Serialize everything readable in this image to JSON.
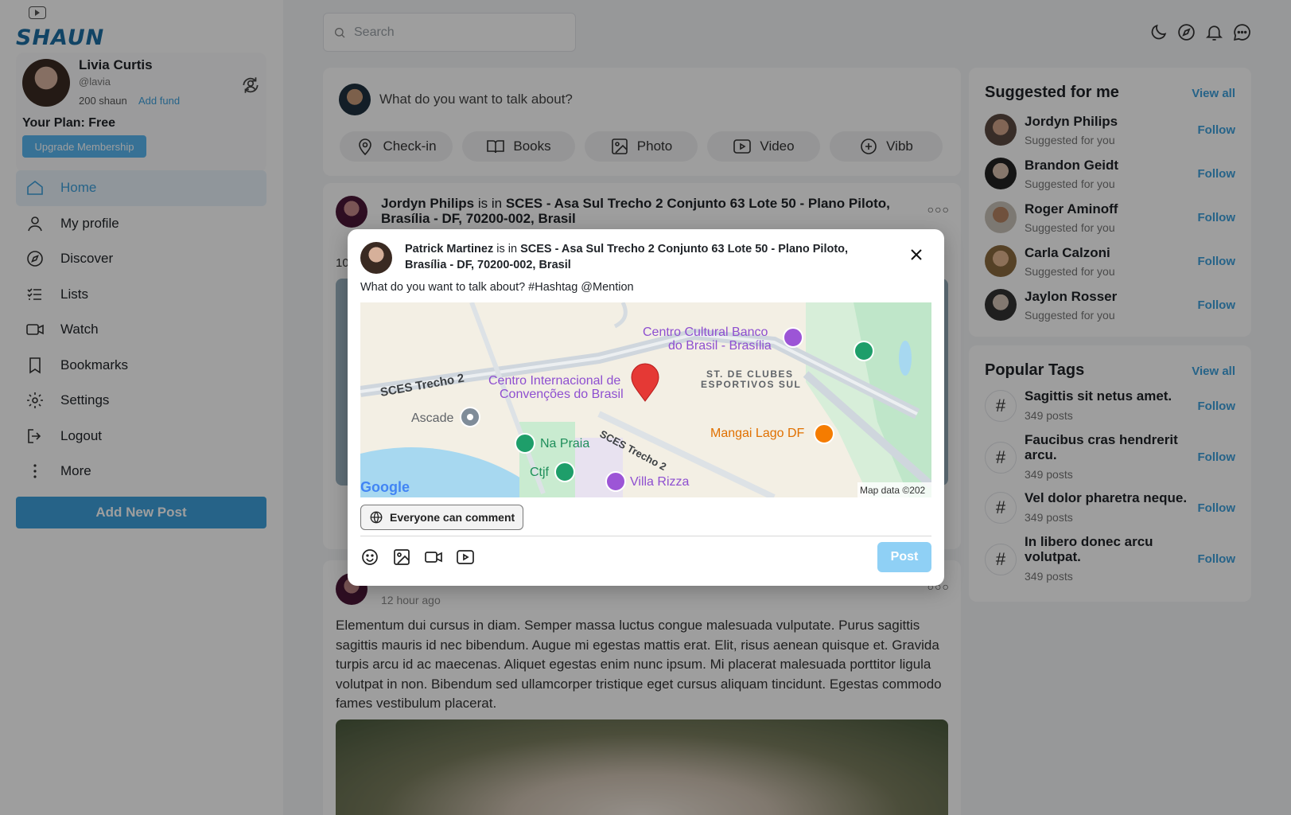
{
  "app": {
    "logo": "SHAUN"
  },
  "profile": {
    "name": "Livia Curtis",
    "handle": "@lavia",
    "balance": "200 shaun",
    "add_fund": "Add fund",
    "plan": "Your Plan: Free",
    "upgrade": "Upgrade Membership"
  },
  "nav": [
    {
      "label": "Home",
      "icon": "home-icon"
    },
    {
      "label": "My profile",
      "icon": "user-icon"
    },
    {
      "label": "Discover",
      "icon": "compass-icon"
    },
    {
      "label": "Lists",
      "icon": "list-icon"
    },
    {
      "label": "Watch",
      "icon": "video-icon"
    },
    {
      "label": "Bookmarks",
      "icon": "bookmark-icon"
    },
    {
      "label": "Settings",
      "icon": "gear-icon"
    },
    {
      "label": "Logout",
      "icon": "logout-icon"
    },
    {
      "label": "More",
      "icon": "more-vertical-icon"
    }
  ],
  "add_post": "Add New Post",
  "search": {
    "placeholder": "Search"
  },
  "composer": {
    "prompt": "What do you want to talk about?",
    "chips": [
      {
        "label": "Check-in",
        "icon": "location-pin-icon"
      },
      {
        "label": "Books",
        "icon": "book-icon"
      },
      {
        "label": "Photo",
        "icon": "image-icon"
      },
      {
        "label": "Video",
        "icon": "video-play-icon"
      },
      {
        "label": "Vibb",
        "icon": "plus-circle-icon"
      }
    ]
  },
  "feed": {
    "post1": {
      "author": "Jordyn Philips",
      "connector": "is in",
      "location": "SCES - Asa Sul Trecho 2 Conjunto 63 Lote 50 - Plano Piloto, Brasília - DF, 70200-002, Brasil",
      "stub": "10"
    },
    "post2": {
      "time": "12 hour ago",
      "body": "Elementum dui cursus in diam. Semper massa luctus congue malesuada vulputate. Purus sagittis sagittis mauris id nec bibendum. Augue mi egestas mattis erat. Elit, risus aenean quisque et. Gravida turpis arcu id ac maecenas. Aliquet egestas enim nunc ipsum. Mi placerat malesuada porttitor ligula volutpat in non. Bibendum sed ullamcorper tristique eget cursus aliquam tincidunt. Egestas commodo fames vestibulum placerat."
    }
  },
  "suggested": {
    "title": "Suggested for me",
    "view_all": "View all",
    "items": [
      {
        "name": "Jordyn Philips",
        "sub": "Suggested for you",
        "action": "Follow"
      },
      {
        "name": "Brandon Geidt",
        "sub": "Suggested for you",
        "action": "Follow"
      },
      {
        "name": "Roger Aminoff",
        "sub": "Suggested for you",
        "action": "Follow"
      },
      {
        "name": "Carla Calzoni",
        "sub": "Suggested for you",
        "action": "Follow"
      },
      {
        "name": "Jaylon Rosser",
        "sub": "Suggested for you",
        "action": "Follow"
      }
    ]
  },
  "tags": {
    "title": "Popular Tags",
    "view_all": "View all",
    "items": [
      {
        "name": "Sagittis sit netus amet.",
        "posts": "349 posts",
        "action": "Follow"
      },
      {
        "name": "Faucibus cras hendrerit arcu.",
        "posts": "349 posts",
        "action": "Follow"
      },
      {
        "name": "Vel dolor pharetra neque.",
        "posts": "349 posts",
        "action": "Follow"
      },
      {
        "name": "In libero donec arcu volutpat.",
        "posts": "349 posts",
        "action": "Follow"
      }
    ]
  },
  "modal": {
    "author": "Patrick Martinez",
    "connector": "is in",
    "location": "SCES - Asa Sul Trecho 2 Conjunto 63 Lote 50 - Plano Piloto, Brasília - DF, 70200-002, Brasil",
    "text": "What do you want to talk about? #Hashtag @Mention",
    "map_labels": {
      "centro_cultural_1": "Centro Cultural Banco",
      "centro_cultural_2": "do Brasil - Brasília",
      "centro_internacional_1": "Centro Internacional de",
      "centro_internacional_2": "Convenções do Brasil",
      "st_clubes_1": "ST. DE CLUBES",
      "st_clubes_2": "ESPORTIVOS SUL",
      "sces_trecho_left": "SCES Trecho 2",
      "sces_trecho_diag": "SCES Trecho 2",
      "ascade": "Ascade",
      "na_praia": "Na Praia",
      "ctjf": "Ctjf",
      "villa_rizza": "Villa Rizza",
      "mangai": "Mangai Lago DF",
      "map_data": "Map data ©202",
      "google": "Google"
    },
    "privacy": "Everyone can comment",
    "post_button": "Post",
    "colors": {
      "accent": "#3ea0dc",
      "post_disabled": "#8fd0f5",
      "map_pin": "#e53935",
      "poi_purple": "#9c55d6",
      "poi_green": "#1e9e6a",
      "poi_orange": "#f57c00"
    }
  }
}
